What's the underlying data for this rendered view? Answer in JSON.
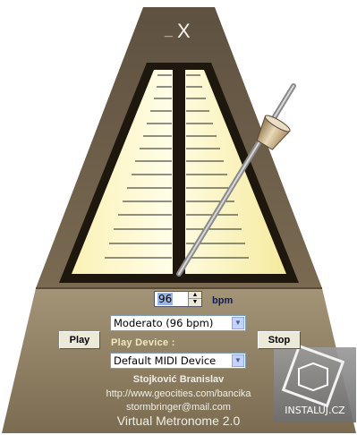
{
  "window": {
    "minimize_label": "_",
    "close_label": "X"
  },
  "tempo": {
    "value": "96",
    "unit": "bpm",
    "selected_tempo": "Moderato (96 bpm)"
  },
  "device": {
    "label": "Play Device :",
    "selected": "Default MIDI Device"
  },
  "buttons": {
    "play": "Play",
    "stop": "Stop"
  },
  "credits": {
    "author": "Stojković Branislav",
    "url": "http://www.geocities.com/bancika",
    "email": "stormbringer@mail.com",
    "app_title": "Virtual Metronome 2.0"
  },
  "watermark": {
    "text": "INSTALUJ.CZ"
  },
  "colors": {
    "body_dark": "#7d6b51",
    "body_light": "#bfae8f",
    "frame": "#2a1f12",
    "face": "#fdf8c0",
    "scale_text": "#0f1d53"
  }
}
